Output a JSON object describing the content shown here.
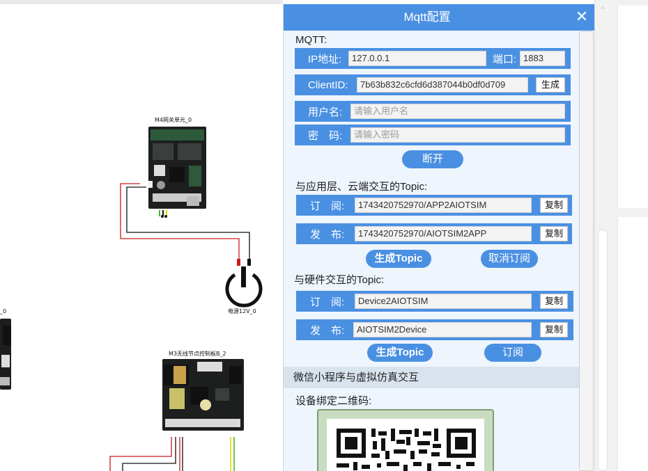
{
  "canvas": {
    "components": [
      {
        "label": "M4网关单元_0"
      },
      {
        "label": "电源12V_0"
      },
      {
        "label": "M3无线节点控制板B_2"
      },
      {
        "label": "_0"
      }
    ]
  },
  "dialog": {
    "title": "Mqtt配置",
    "close_icon": "close-icon",
    "mqtt_heading": "MQTT:",
    "ip_label": "IP地址:",
    "ip_value": "127.0.0.1",
    "port_label": "端口:",
    "port_value": "1883",
    "clientid_label": "ClientID:",
    "clientid_value": "7b63b832c6cfd6d387044b0df0d709",
    "generate_label": "生成",
    "username_label": "用户名:",
    "username_placeholder": "请输入用户名",
    "password_label": "密　码:",
    "password_placeholder": "请输入密码",
    "disconnect_label": "断开",
    "app_topic_heading": "与应用层、云端交互的Topic:",
    "app_subscribe_label": "订　阅:",
    "app_subscribe_value": "1743420752970/APP2AIOTSIM",
    "app_publish_label": "发　布:",
    "app_publish_value": "1743420752970/AIOTSIM2APP",
    "copy_label": "复制",
    "gen_topic_label": "生成Topic",
    "unsubscribe_label": "取消订阅",
    "hw_topic_heading": "与硬件交互的Topic:",
    "hw_subscribe_label": "订　阅:",
    "hw_subscribe_value": "Device2AIOTSIM",
    "hw_publish_label": "发　布:",
    "hw_publish_value": "AIOTSIM2Device",
    "subscribe_label": "订阅",
    "wechat_section": "微信小程序与虚拟仿真交互",
    "qr_heading": "设备绑定二维码:"
  },
  "colors": {
    "accent": "#4a90e2",
    "panel_bg": "#eef5fd",
    "section_band": "#d9e3ee",
    "wire_red": "#cc1a1a",
    "wire_black": "#111111",
    "wire_yellow": "#e3d400",
    "wire_green": "#3cbf2c"
  }
}
